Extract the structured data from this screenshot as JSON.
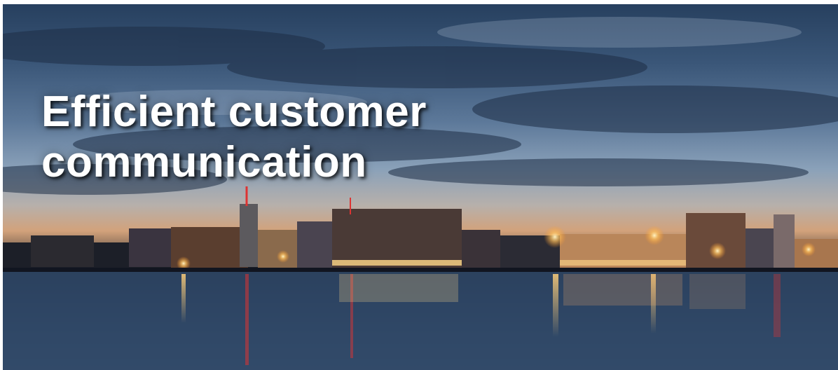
{
  "headline": {
    "line1": "Efficient customer",
    "line2": "communication"
  },
  "scene": {
    "description_icon": "city-skyline-night-image",
    "colors": {
      "sky_top": "#27405f",
      "sky_mid": "#8aa1b9",
      "horizon_glow": "#d2a27b",
      "water": "#3c5777",
      "lights": "#ffcf7a"
    }
  }
}
